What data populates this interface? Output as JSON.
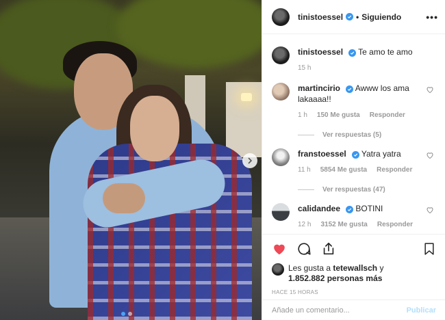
{
  "post": {
    "author": "tinistoessel",
    "separator": "•",
    "follow_status": "Siguiendo",
    "more_label": "•••"
  },
  "caption": {
    "username": "tinistoessel",
    "text": "Te amo te amo",
    "time": "15 h"
  },
  "comments": [
    {
      "username": "martincirio",
      "text": "Awww los ama lakaaaa!!",
      "time": "1 h",
      "likes": "150 Me gusta",
      "reply": "Responder",
      "view_replies": "Ver respuestas (5)",
      "verified": true
    },
    {
      "username": "franstoessel",
      "text": "Yatra yatra",
      "time": "11 h",
      "likes": "5854 Me gusta",
      "reply": "Responder",
      "view_replies": "Ver respuestas (47)",
      "verified": true
    },
    {
      "username": "calidandee",
      "text": "BOTINI",
      "time": "12 h",
      "likes": "3152 Me gusta",
      "reply": "Responder",
      "verified": true
    }
  ],
  "likes": {
    "prefix": "Les gusta a",
    "user": "tetewallsch",
    "connector": "y",
    "count": "1.852.882 personas más"
  },
  "timestamp": "HACE 15 HORAS",
  "add_comment": {
    "placeholder": "Añade un comentario...",
    "post_label": "Publicar"
  },
  "colors": {
    "verified": "#3897f0",
    "liked_heart": "#ed4956",
    "publish_disabled": "#b2dffc"
  },
  "icons": [
    "chevron-right-icon",
    "verified-icon",
    "heart-icon",
    "comment-icon",
    "share-icon",
    "bookmark-icon"
  ]
}
